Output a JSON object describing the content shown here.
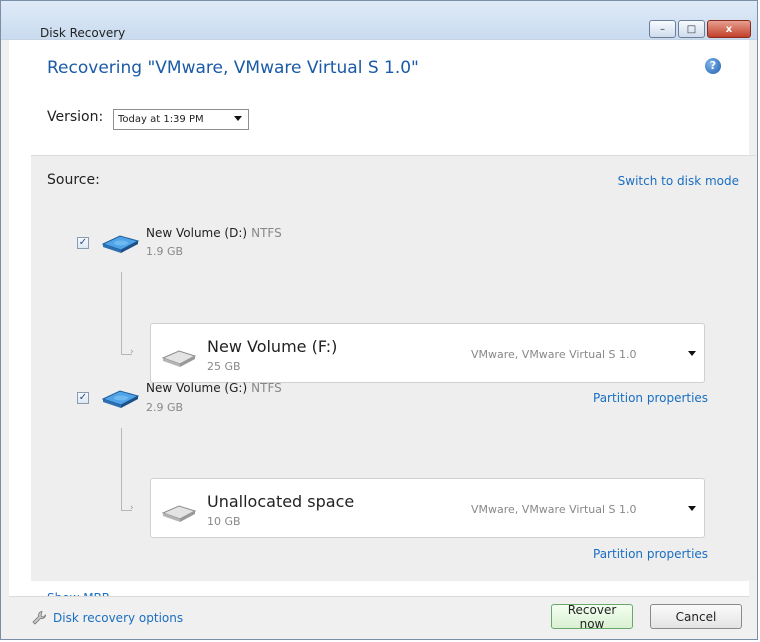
{
  "window": {
    "title": "Disk Recovery",
    "controls": {
      "minimize": "–",
      "maximize": "□",
      "close": "x"
    }
  },
  "header": {
    "heading": "Recovering \"VMware, VMware Virtual S 1.0\"",
    "help_glyph": "?"
  },
  "version": {
    "label": "Version:",
    "selected": "Today at 1:39 PM"
  },
  "source": {
    "label": "Source:",
    "switch_link": "Switch to disk mode",
    "volumes": [
      {
        "checked": true,
        "check_glyph": "✓",
        "name": "New Volume (D:)",
        "fs": "NTFS",
        "size": "1.9 GB",
        "target": {
          "name": "New Volume (F:)",
          "size": "25 GB",
          "disk": "VMware, VMware Virtual S 1.0"
        },
        "properties_link": "Partition properties"
      },
      {
        "checked": true,
        "check_glyph": "✓",
        "name": "New Volume (G:)",
        "fs": "NTFS",
        "size": "2.9 GB",
        "target": {
          "name": "Unallocated space",
          "size": "10 GB",
          "disk": "VMware, VMware Virtual S 1.0"
        },
        "properties_link": "Partition properties"
      }
    ],
    "show_mbr": "Show MBR"
  },
  "footer": {
    "options_link": "Disk recovery options",
    "recover_button": "Recover now",
    "cancel_button": "Cancel"
  },
  "colors": {
    "accent": "#1a5aa6",
    "link": "#1a6fc2",
    "panel_bg": "#eeeeee"
  },
  "icons": {
    "help": "help-icon",
    "volume": "hard-disk-icon",
    "target": "hard-disk-gray-icon",
    "options": "wrench-icon",
    "dropdown": "chevron-down-icon"
  }
}
